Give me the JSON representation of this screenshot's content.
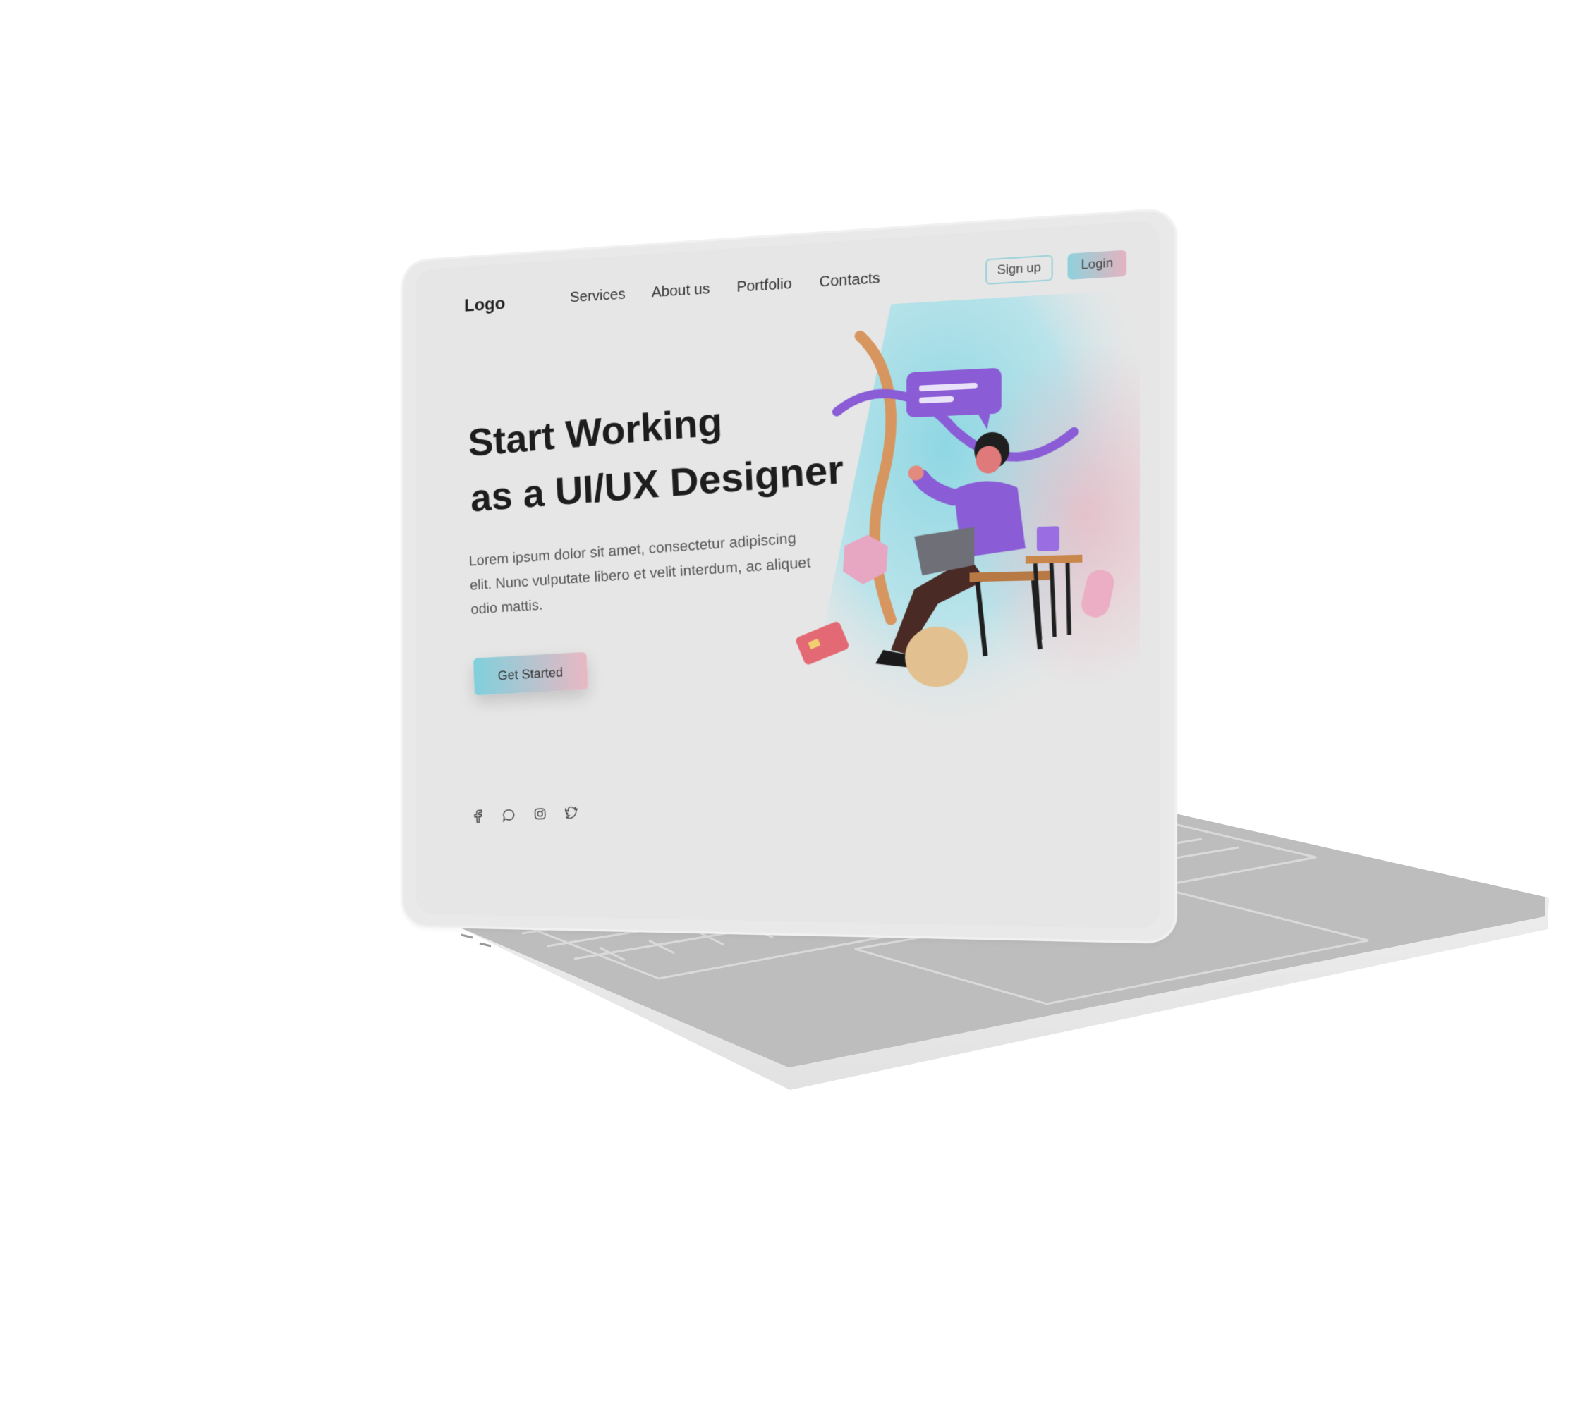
{
  "site": {
    "logo": "Logo",
    "nav": [
      {
        "label": "Services"
      },
      {
        "label": "About us"
      },
      {
        "label": "Portfolio"
      },
      {
        "label": "Contacts"
      }
    ],
    "actions": {
      "signup_label": "Sign up",
      "login_label": "Login"
    }
  },
  "hero": {
    "title_line1": "Start Working",
    "title_line2": "as a UI/UX Designer",
    "body": "Lorem ipsum dolor sit amet, consectetur adipiscing elit. Nunc vulputate libero et velit interdum, ac aliquet odio mattis.",
    "cta_label": "Get Started"
  },
  "social": [
    {
      "icon": "facebook-icon"
    },
    {
      "icon": "chat-bubble-icon"
    },
    {
      "icon": "instagram-icon"
    },
    {
      "icon": "twitter-icon"
    }
  ],
  "colors": {
    "accent_teal": "#8ed1dc",
    "accent_pink": "#e4b3bf",
    "purple": "#8a5cd6",
    "screen_bg": "#e6e6e6",
    "laptop_body": "#bfbfbf"
  }
}
